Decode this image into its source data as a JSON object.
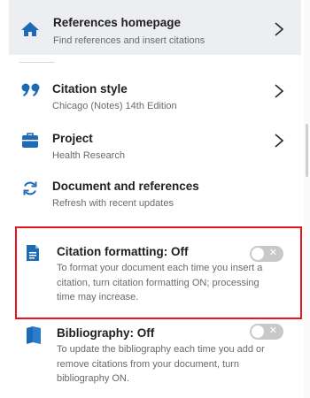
{
  "colors": {
    "accent": "#1e6ab5",
    "highlight": "#e8161c",
    "toggle_off": "#c8c8c8"
  },
  "references_home": {
    "title": "References homepage",
    "subtitle": "Find references and insert citations",
    "icon": "home-icon"
  },
  "citation_style": {
    "title": "Citation style",
    "subtitle": "Chicago (Notes) 14th Edition",
    "icon": "quote-icon"
  },
  "project": {
    "title": "Project",
    "subtitle": "Health Research",
    "icon": "briefcase-icon"
  },
  "document_refs": {
    "title": "Document and references",
    "subtitle": "Refresh with recent updates",
    "icon": "sync-icon"
  },
  "citation_formatting": {
    "title": "Citation formatting: Off",
    "description": "To format your document each time you insert a citation, turn citation formatting ON; processing time may increase.",
    "icon": "document-icon",
    "toggle_state": "off"
  },
  "bibliography": {
    "title": "Bibliography: Off",
    "description": "To update the bibliography each time you add or remove citations from your document, turn bibliography ON.",
    "icon": "book-icon",
    "toggle_state": "off"
  }
}
